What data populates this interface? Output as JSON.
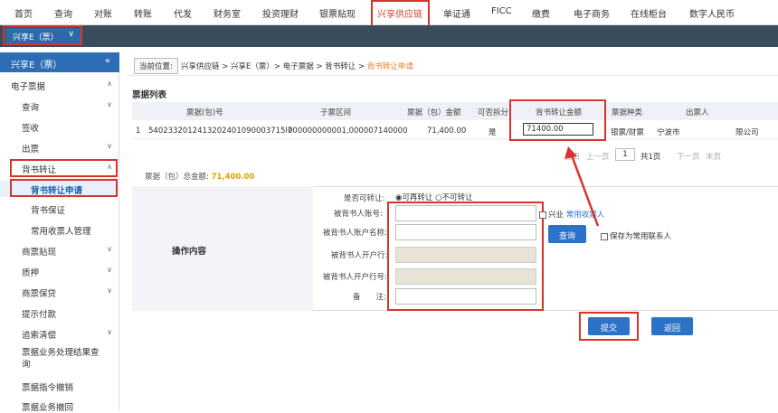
{
  "topnav": {
    "items": [
      "首页",
      "查询",
      "对账",
      "转账",
      "代发",
      "财务室",
      "投资理财",
      "银票贴现",
      "兴享供应链",
      "单证通",
      "FICC",
      "缴费",
      "电子商务",
      "在线柜台",
      "数字人民币"
    ]
  },
  "subbar": {
    "selected": "兴享E（票）"
  },
  "sidebar": {
    "header": "兴享E（票）",
    "collapse_icon": "«",
    "items": [
      {
        "label": "电子票据",
        "chev": "∧",
        "group": true
      },
      {
        "label": "查询",
        "chev": "∨",
        "group": false
      },
      {
        "label": "签收",
        "chev": "",
        "group": false
      },
      {
        "label": "出票",
        "chev": "∨",
        "group": false
      },
      {
        "label": "背书转让",
        "chev": "∧",
        "group": false
      },
      {
        "label": "背书转让申请",
        "chev": "",
        "group": false,
        "active": true
      },
      {
        "label": "背书保证",
        "chev": "",
        "group": false
      },
      {
        "label": "常用收票人管理",
        "chev": "",
        "group": false
      },
      {
        "label": "商票贴现",
        "chev": "∨",
        "group": false
      },
      {
        "label": "质押",
        "chev": "∨",
        "group": false
      },
      {
        "label": "商票保贷",
        "chev": "∨",
        "group": false
      },
      {
        "label": "提示付款",
        "chev": "",
        "group": false
      },
      {
        "label": "追索清偿",
        "chev": "∨",
        "group": false
      },
      {
        "label": "票据业务处理结果查询",
        "chev": "",
        "group": false
      },
      {
        "label": "票据指令撤销",
        "chev": "",
        "group": false
      },
      {
        "label": "票据业务撤回",
        "chev": "",
        "group": false
      }
    ]
  },
  "breadcrumb": {
    "button": "当前位置:",
    "path": "兴享供应链 > 兴享E（票）> 电子票据 > 背书转让 > ",
    "current": "背书转让申请"
  },
  "list": {
    "title": "票据列表",
    "headers": [
      "票据(包)号",
      "子票区间",
      "票据（包）金额",
      "可否拆分",
      "背书转让金额",
      "票据种类",
      "出票人"
    ],
    "row": {
      "index": "1",
      "bill_no": "5402332012413202401090003715l7",
      "range": "000000000001,000007140000",
      "amount": "71,400.00",
      "splittable": "是",
      "transfer_amount": "71400.00",
      "type": "银票/财票",
      "drawer_left": "宁波市",
      "drawer_right": "限公司"
    }
  },
  "pager": {
    "first": "首页",
    "prev": "上一页",
    "page": "1",
    "total": "共1页",
    "next": "下一页",
    "last": "末页"
  },
  "total": {
    "label": "票据（包）总金额:",
    "amount": "71,400.00"
  },
  "form": {
    "section_label": "操作内容",
    "transferable_label": "是否可转让:",
    "radio_yes": "可再转让",
    "radio_no": "不可转让",
    "account_label": "被背书人账号:",
    "name_label": "被背书人账户名称:",
    "bank_label": "被背书人开户行:",
    "bank_no_label": "被背书人开户行号:",
    "note_label": "备　　注:",
    "xingye_label": "兴业",
    "common_payee": "常用收票人",
    "query_button": "查询",
    "save_label": "保存为常用联系人"
  },
  "actions": {
    "submit": "提交",
    "back": "返回"
  },
  "colors": {
    "accent": "#2c73c8",
    "highlight": "#d9342b",
    "amount": "#e0a000",
    "sidebar_head": "#2c6db5"
  }
}
